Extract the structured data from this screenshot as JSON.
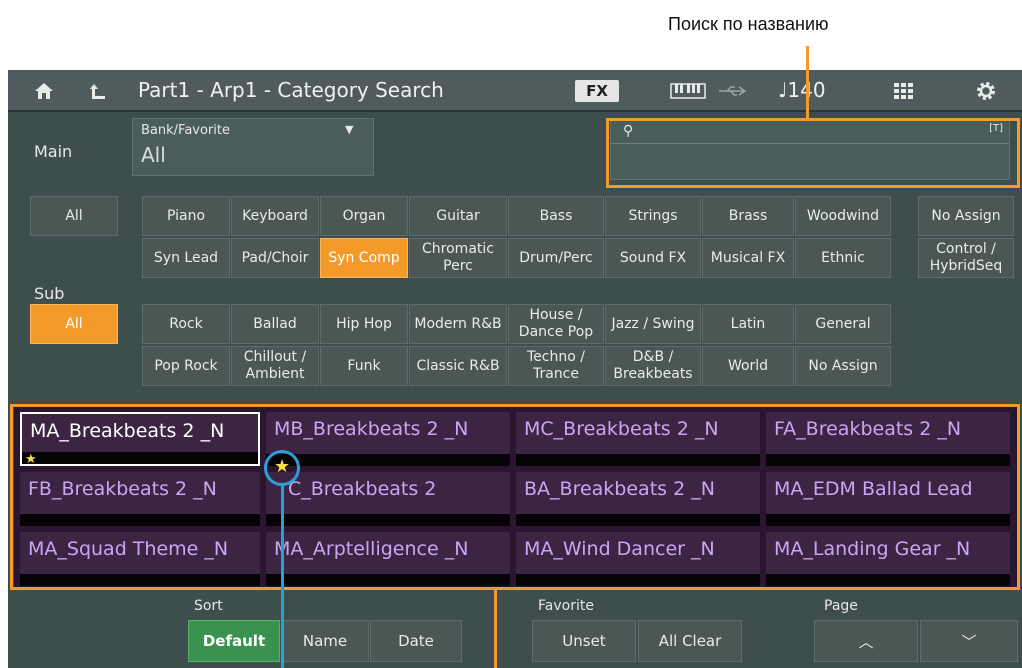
{
  "annotation": {
    "label": "Поиск по названию"
  },
  "header": {
    "title": "Part1 - Arp1 - Category Search",
    "fx_label": "FX",
    "tempo": "♩140"
  },
  "main": {
    "label": "Main",
    "bank": {
      "label": "Bank/Favorite",
      "value": "All"
    },
    "search": {
      "placeholder": "",
      "keyboard_hint": "[T]"
    },
    "all_label": "All",
    "categories": [
      [
        "Piano",
        "Keyboard",
        "Organ",
        "Guitar",
        "Bass",
        "Strings",
        "Brass",
        "Woodwind",
        "No Assign"
      ],
      [
        "Syn Lead",
        "Pad/Choir",
        "Syn Comp",
        "Chromatic Perc",
        "Drum/Perc",
        "Sound FX",
        "Musical FX",
        "Ethnic",
        "Control / HybridSeq"
      ]
    ],
    "selected": "Syn Comp"
  },
  "sub": {
    "label": "Sub",
    "all_label": "All",
    "categories": [
      [
        "Rock",
        "Ballad",
        "Hip Hop",
        "Modern R&B",
        "House / Dance Pop",
        "Jazz / Swing",
        "Latin",
        "General"
      ],
      [
        "Pop Rock",
        "Chillout / Ambient",
        "Funk",
        "Classic R&B",
        "Techno / Trance",
        "D&B / Breakbeats",
        "World",
        "No Assign"
      ]
    ],
    "selected": "All"
  },
  "results": [
    [
      "MA_Breakbeats 2 _N",
      "MB_Breakbeats 2 _N",
      "MC_Breakbeats 2 _N",
      "FA_Breakbeats 2 _N"
    ],
    [
      "FB_Breakbeats 2 _N",
      "C_Breakbeats 2",
      "BA_Breakbeats 2 _N",
      "MA_EDM Ballad Lead"
    ],
    [
      "MA_Squad Theme _N",
      "MA_Arptelligence _N",
      "MA_Wind Dancer _N",
      "MA_Landing Gear _N"
    ]
  ],
  "sort": {
    "label": "Sort",
    "options": [
      "Default",
      "Name",
      "Date"
    ],
    "selected": "Default"
  },
  "favorite": {
    "label": "Favorite",
    "unset": "Unset",
    "all_clear": "All Clear"
  },
  "page": {
    "label": "Page"
  },
  "colors": {
    "accent": "#f39a2b",
    "selected_green": "#3b9150",
    "result_text": "#c9a6f3",
    "star": "#f5e04a",
    "annotation_blue": "#2aa0d8"
  }
}
